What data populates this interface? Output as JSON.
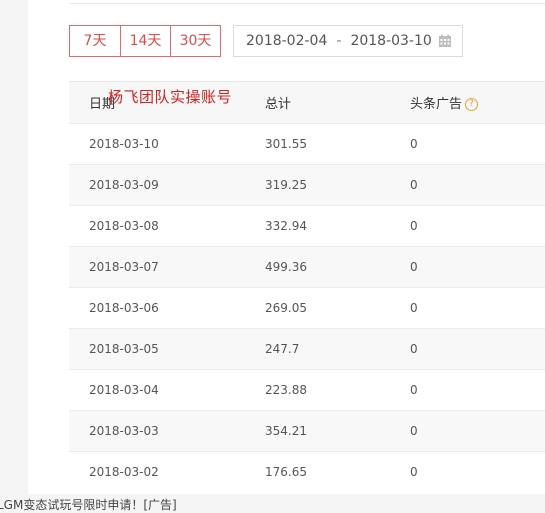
{
  "range_buttons": [
    "7天",
    "14天",
    "30天"
  ],
  "date_range": {
    "start": "2018-02-04",
    "separator": "-",
    "end": "2018-03-10"
  },
  "watermark": "杨飞团队实操账号",
  "table": {
    "headers": {
      "date": "日期",
      "total": "总计",
      "toutiao_ads": "头条广告",
      "help": "?"
    },
    "rows": [
      {
        "date": "2018-03-10",
        "total": "301.55",
        "ads": "0"
      },
      {
        "date": "2018-03-09",
        "total": "319.25",
        "ads": "0"
      },
      {
        "date": "2018-03-08",
        "total": "332.94",
        "ads": "0"
      },
      {
        "date": "2018-03-07",
        "total": "499.36",
        "ads": "0"
      },
      {
        "date": "2018-03-06",
        "total": "269.05",
        "ads": "0"
      },
      {
        "date": "2018-03-05",
        "total": "247.7",
        "ads": "0"
      },
      {
        "date": "2018-03-04",
        "total": "223.88",
        "ads": "0"
      },
      {
        "date": "2018-03-03",
        "total": "354.21",
        "ads": "0"
      },
      {
        "date": "2018-03-02",
        "total": "176.65",
        "ads": "0"
      }
    ]
  },
  "footer": "LGM变态试玩号限时申请！[广告]",
  "colors": {
    "accent": "#e04a4a",
    "help_icon": "#f0a030"
  }
}
